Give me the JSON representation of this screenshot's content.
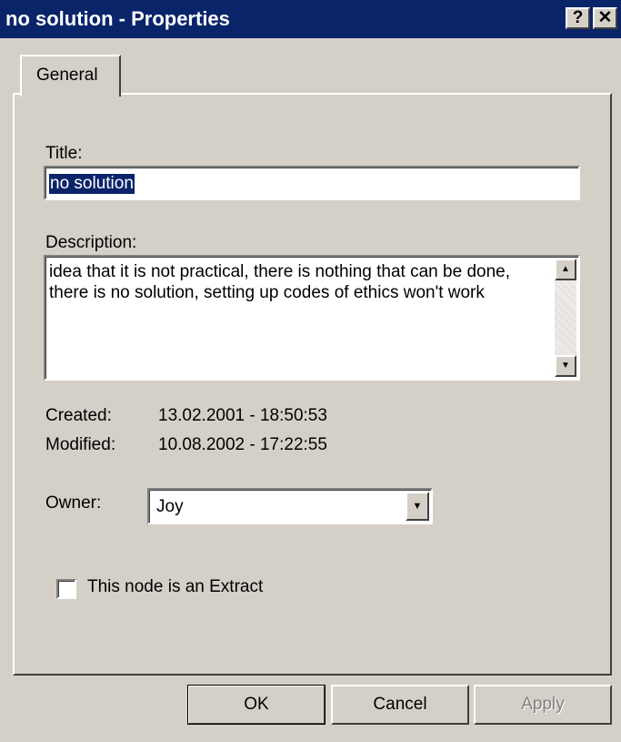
{
  "window": {
    "title": "no solution - Properties",
    "help_glyph": "?",
    "close_glyph": "✕"
  },
  "tabs": [
    {
      "label": "General",
      "selected": true
    }
  ],
  "general": {
    "title_label": "Title:",
    "title_value": "no solution",
    "description_label": "Description:",
    "description_value": "idea that it is not practical, there is nothing that can be done, there is no solution, setting up codes of ethics won't work",
    "created_label": "Created:",
    "created_value": "13.02.2001 - 18:50:53",
    "modified_label": "Modified:",
    "modified_value": "10.08.2002 - 17:22:55",
    "owner_label": "Owner:",
    "owner_value": "Joy",
    "extract_label": "This node is an Extract",
    "extract_checked": false
  },
  "buttons": {
    "ok": "OK",
    "cancel": "Cancel",
    "apply": "Apply",
    "apply_enabled": false
  },
  "colors": {
    "titlebar": "#0a246a",
    "face": "#d4d0c8",
    "selection": "#0a246a"
  },
  "icons": {
    "help": "help-icon",
    "close": "close-icon",
    "scroll_up": "arrow-up-icon",
    "scroll_down": "arrow-down-icon",
    "dropdown": "chevron-down-icon"
  }
}
